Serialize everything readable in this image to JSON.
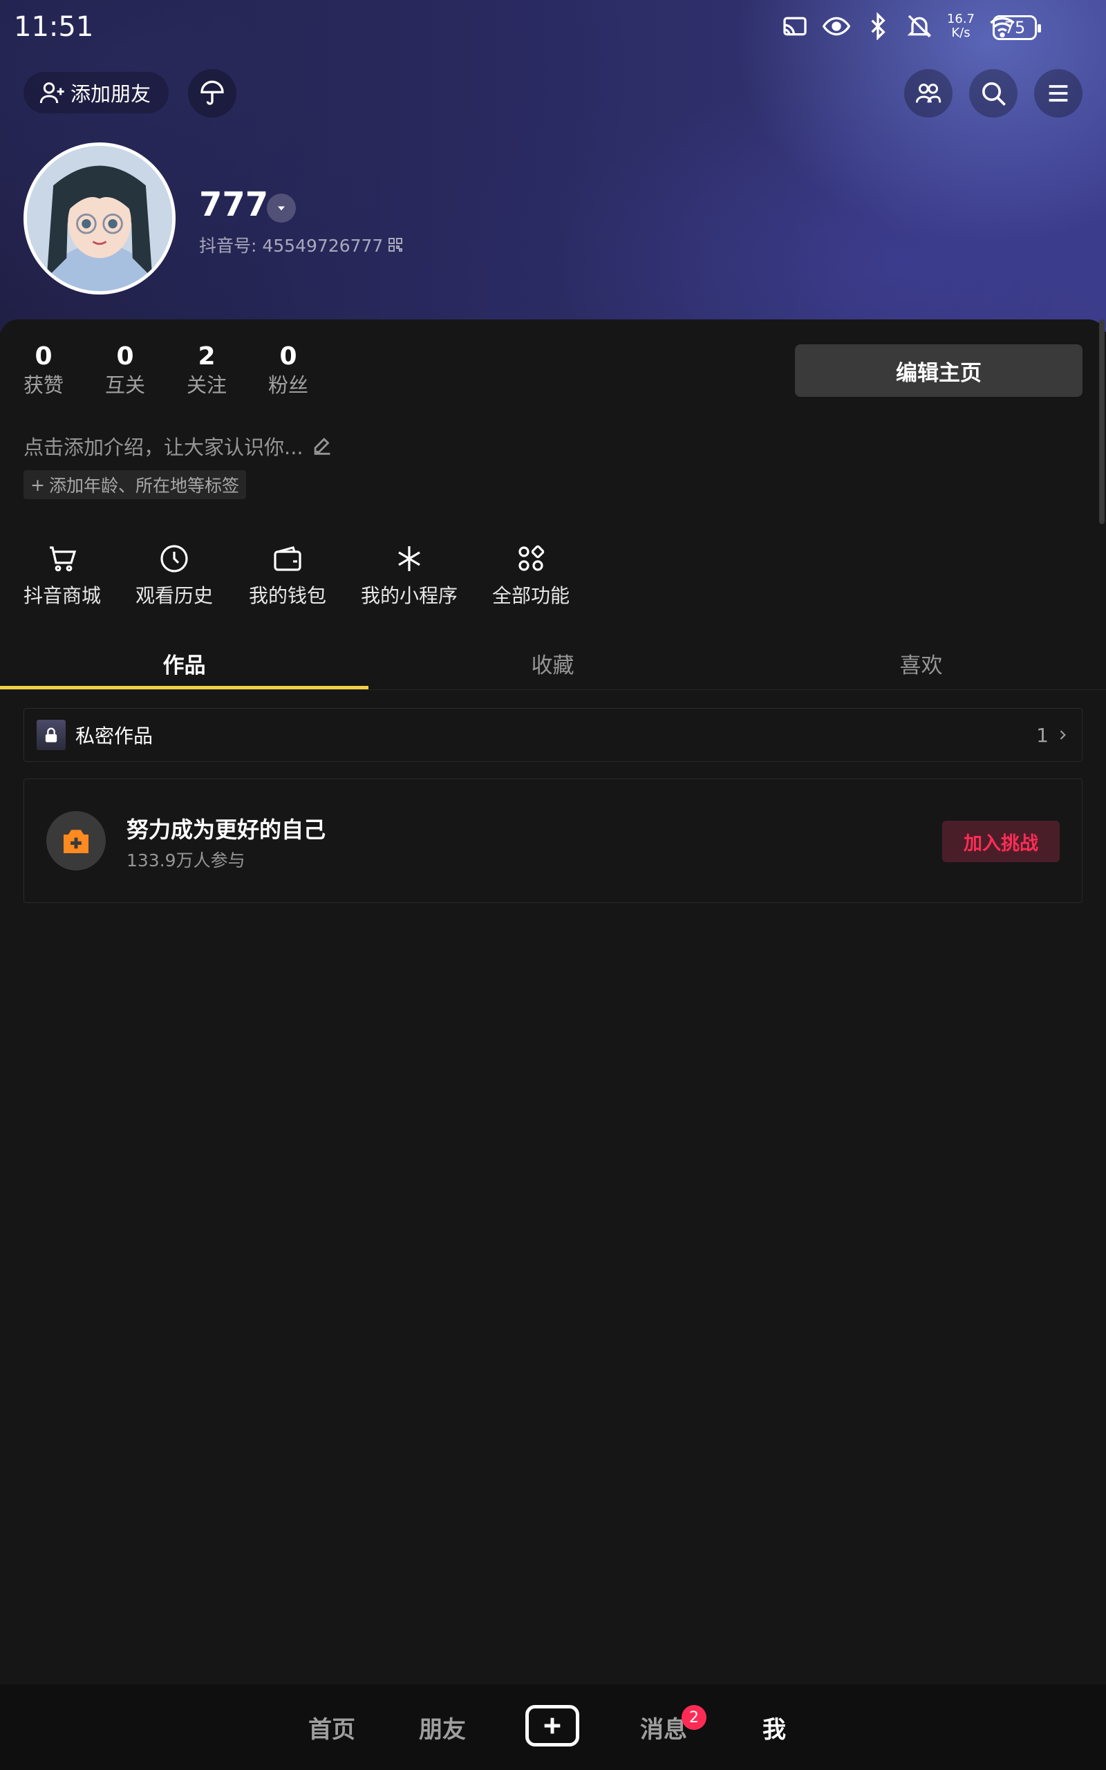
{
  "status_bar": {
    "time": "11:51",
    "net_speed_value": "16.7",
    "net_speed_unit": "K/s",
    "battery": "75",
    "icons": [
      "cast-icon",
      "eye-icon",
      "bluetooth-icon",
      "mute-bell-icon",
      "wifi-icon",
      "battery-icon"
    ]
  },
  "header": {
    "add_friend_label": "添加朋友",
    "umbrella_icon": "umbrella-icon",
    "friends_icon": "friends-icon",
    "search_icon": "search-icon",
    "menu_icon": "menu-icon"
  },
  "profile": {
    "username": "777",
    "douyin_id": "抖音号: 45549726777"
  },
  "stats": [
    {
      "value": "0",
      "label": "获赞"
    },
    {
      "value": "0",
      "label": "互关"
    },
    {
      "value": "2",
      "label": "关注"
    },
    {
      "value": "0",
      "label": "粉丝"
    }
  ],
  "edit_button_label": "编辑主页",
  "bio_placeholder": "点击添加介绍，让大家认识你...",
  "tag_add_label": "添加年龄、所在地等标签",
  "shortcuts": [
    {
      "label": "抖音商城",
      "icon": "cart-icon"
    },
    {
      "label": "观看历史",
      "icon": "clock-icon"
    },
    {
      "label": "我的钱包",
      "icon": "wallet-icon"
    },
    {
      "label": "我的小程序",
      "icon": "mini-program-icon"
    },
    {
      "label": "全部功能",
      "icon": "grid-icon"
    }
  ],
  "tabs": [
    "作品",
    "收藏",
    "喜欢"
  ],
  "active_tab": "作品",
  "private_works": {
    "label": "私密作品",
    "count": "1"
  },
  "challenge": {
    "title": "努力成为更好的自己",
    "participants": "133.9万人参与",
    "join_label": "加入挑战"
  },
  "bottom_nav": {
    "items": [
      "首页",
      "朋友",
      "消息",
      "我"
    ],
    "active": "我",
    "message_badge": "2"
  },
  "colors": {
    "accent_underline": "#f2d045",
    "badge_red": "#fe2c55",
    "background": "#161616"
  }
}
